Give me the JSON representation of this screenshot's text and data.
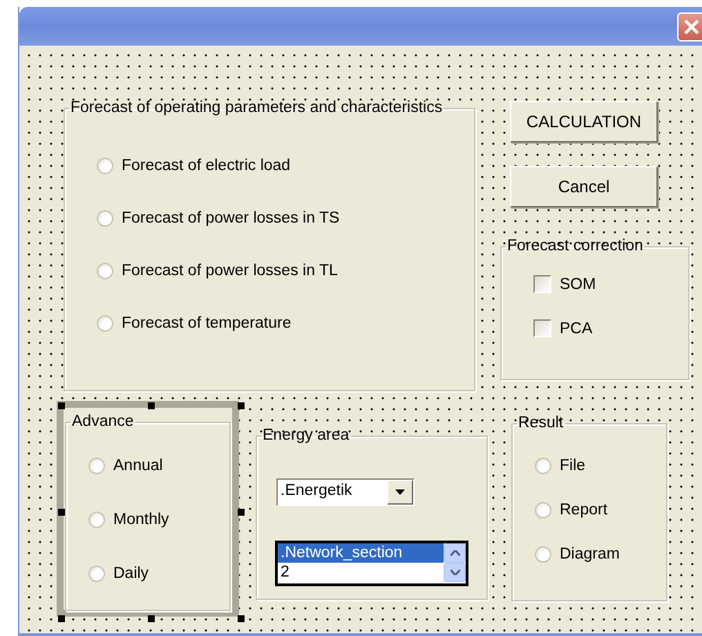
{
  "forecast": {
    "title": "Forecast of operating parameters and characteristics",
    "options": [
      {
        "label": "Forecast of electric load",
        "selected": false
      },
      {
        "label": "Forecast of power losses in TS",
        "selected": false
      },
      {
        "label": "Forecast of power losses in TL",
        "selected": false
      },
      {
        "label": "Forecast of temperature",
        "selected": false
      }
    ]
  },
  "buttons": [
    {
      "label": "CALCULATION"
    },
    {
      "label": "Cancel"
    }
  ],
  "correction": {
    "title": "Forecast correction",
    "options": [
      {
        "label": "SOM",
        "checked": false
      },
      {
        "label": "PCA",
        "checked": false
      }
    ]
  },
  "advance": {
    "title": "Advance",
    "design_selected": true,
    "options": [
      {
        "label": "Annual",
        "selected": false
      },
      {
        "label": "Monthly",
        "selected": false
      },
      {
        "label": "Daily",
        "selected": false
      }
    ]
  },
  "energy_area": {
    "title": "Energy area",
    "combo_value": ".Energetik",
    "list_items": [
      {
        "label": ".Network_section",
        "selected": true
      },
      {
        "label": "2",
        "selected": false
      }
    ]
  },
  "result": {
    "title": "Result",
    "options": [
      {
        "label": "File",
        "selected": false
      },
      {
        "label": "Report",
        "selected": false
      },
      {
        "label": "Diagram",
        "selected": false
      }
    ]
  }
}
